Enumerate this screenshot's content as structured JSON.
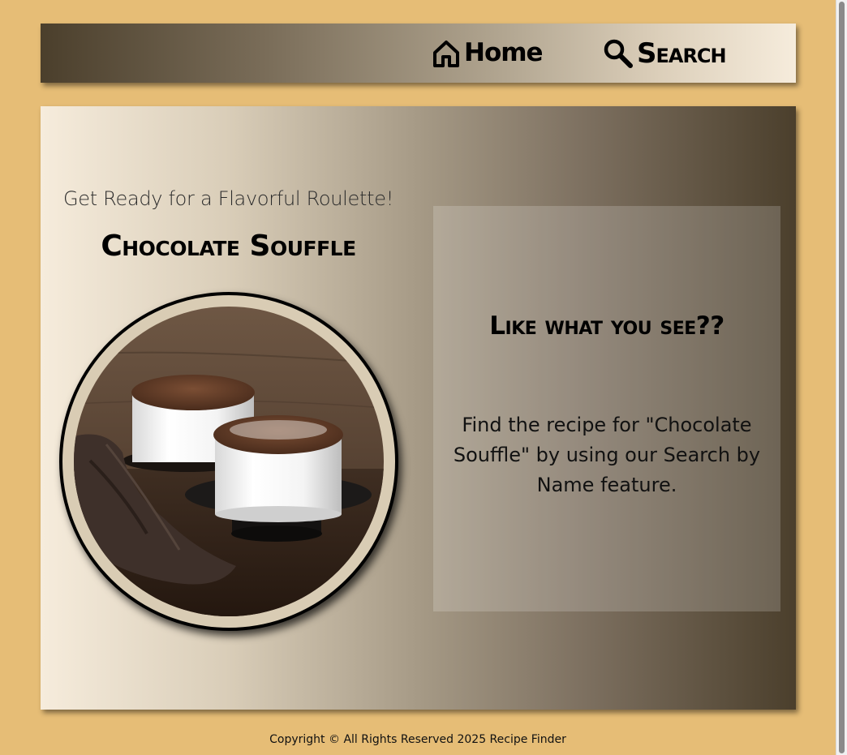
{
  "nav": {
    "home_label": "Home",
    "home_icon": "home-icon",
    "search_label": "Search",
    "search_icon": "search-icon"
  },
  "main": {
    "tagline": "Get Ready for a Flavorful Roulette!",
    "recipe_title": "Chocolate Souffle",
    "photo_alt": "Chocolate Souffle"
  },
  "info": {
    "heading": "Like what you see??",
    "text": "Find the recipe for \"Chocolate Souffle\" by using our Search by Name feature."
  },
  "footer": {
    "copyright": "Copyright © All Rights Reserved 2025 Recipe Finder"
  },
  "colors": {
    "page_background": "#e6bd76",
    "gradient_dark": "#4b3f2c",
    "gradient_light": "#f6ecdc"
  }
}
